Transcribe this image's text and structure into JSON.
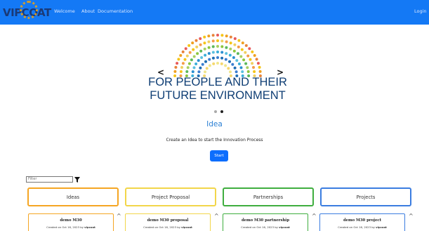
{
  "navbar": {
    "brand": "VIPCOAT",
    "links": [
      "Welcome",
      "About",
      "Documentation"
    ],
    "login": "Login"
  },
  "carousel": {
    "prev": "<",
    "next": ">",
    "headline_line1": "FOR PEOPLE AND THEIR",
    "headline_line2": "FUTURE ENVIRONMENT",
    "slides": 2,
    "active_slide": 2
  },
  "hero": {
    "title": "Idea",
    "description": "Create an Idea to start the Innovation Process",
    "button": "Start"
  },
  "filter": {
    "placeholder": "Filter",
    "icon": "funnel-icon"
  },
  "categories": [
    {
      "label": "Ideas",
      "color": "#f5a623"
    },
    {
      "label": "Project Proposal",
      "color": "#f2d64a"
    },
    {
      "label": "Partnerships",
      "color": "#3fae3f"
    },
    {
      "label": "Projects",
      "color": "#3b7de0"
    }
  ],
  "cards": [
    {
      "title": "demo M30",
      "created": "Created on Oct 16, 2023 by",
      "author": "vipcoat"
    },
    {
      "title": "demo M30 proposal",
      "created": "Created on Oct 16, 2023 by",
      "author": "vipcoat"
    },
    {
      "title": "demo M30 partnership",
      "created": "Created on Oct 16, 2023 by",
      "author": "vipcoat"
    },
    {
      "title": "demo M30 project",
      "created": "Created on Oct 16, 2023 by",
      "author": "vipcoat"
    }
  ],
  "caret": "^"
}
